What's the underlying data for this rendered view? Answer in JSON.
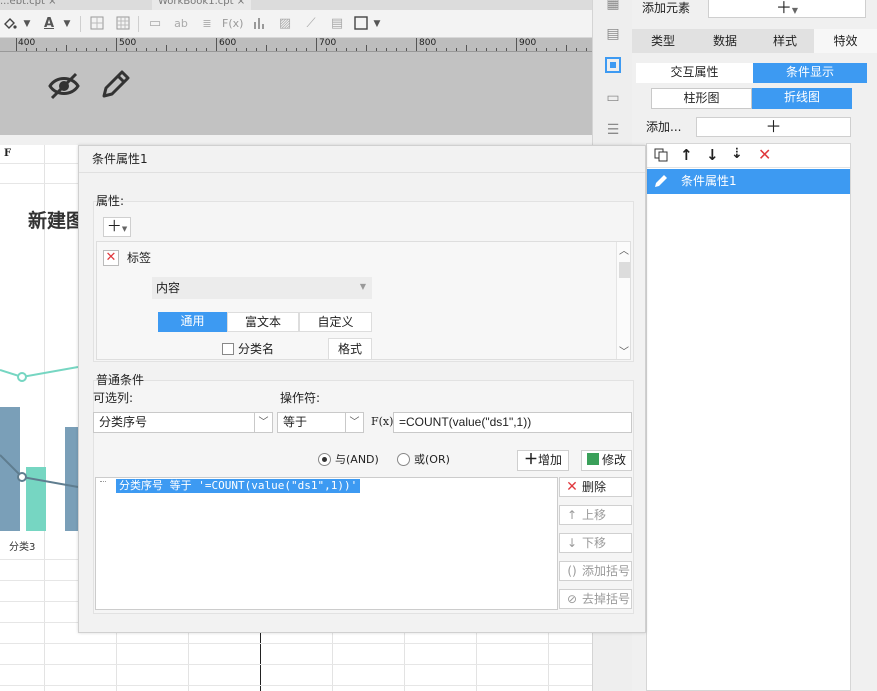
{
  "tabs": [
    "...ebt.cpt ×",
    "WorkBook1.cpt ×"
  ],
  "ruler": [
    "400",
    "500",
    "600",
    "700",
    "800",
    "900"
  ],
  "right_panel": {
    "add_element_label": "添加元素",
    "tabs": [
      "类型",
      "数据",
      "样式",
      "特效"
    ],
    "sub_tabs": [
      "交互属性",
      "条件显示"
    ],
    "chart_tabs": [
      "柱形图",
      "折线图"
    ],
    "add_label": "添加...",
    "list_item": "条件属性1"
  },
  "sheet": {
    "col_header": "F",
    "title": "新建图",
    "category_label": "分类3"
  },
  "dialog": {
    "title": "条件属性1",
    "attr_label": "属性:",
    "tag_label": "标签",
    "content_label": "内容",
    "content_tabs": [
      "通用",
      "富文本",
      "自定义"
    ],
    "category_name": "分类名",
    "format_label": "格式",
    "normal_condition": "普通条件",
    "optional_column_label": "可选列:",
    "operator_label": "操作符:",
    "column_value": "分类序号",
    "operator_value": "等于",
    "formula_value": "=COUNT(value(\"ds1\",1))",
    "fx_label": "F(x)",
    "and_label": "与(AND)",
    "or_label": "或(OR)",
    "add_button": "增加",
    "modify_button": "修改",
    "condition_text": "分类序号 等于 '=COUNT(value(\"ds1\",1))'",
    "delete_button": "删除",
    "up_button": "上移",
    "down_button": "下移",
    "add_bracket_button": "添加括号",
    "remove_bracket_button": "去掉括号"
  },
  "colors": {
    "accent": "#3d9af2",
    "delete_red": "#e0393e",
    "chart_bar": "#7a9fb8",
    "chart_teal": "#76d6c2"
  }
}
